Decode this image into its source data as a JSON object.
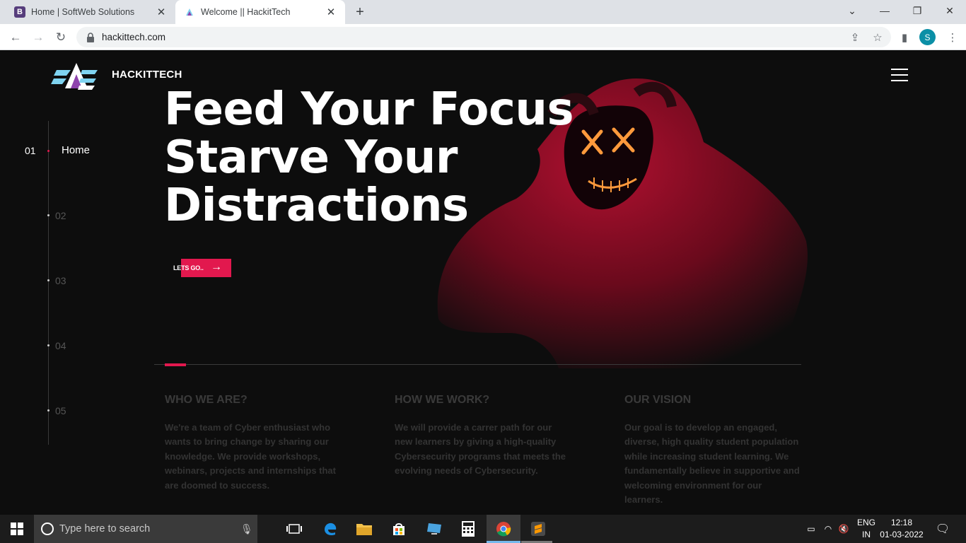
{
  "browser": {
    "tabs": [
      {
        "title": "Home | SoftWeb Solutions",
        "favicon": "B"
      },
      {
        "title": "Welcome || HackitTech"
      }
    ],
    "url": "hackittech.com",
    "profile_initial": "S"
  },
  "site": {
    "brand": "HACKITTECH",
    "headline": [
      "Feed Your Focus",
      "Starve Your",
      "Distractions"
    ],
    "cta": "LETS GO..",
    "nav": {
      "current_num": "01",
      "current_label": "Home",
      "items": [
        "02",
        "03",
        "04",
        "05"
      ]
    },
    "columns": [
      {
        "title": "WHO WE ARE?",
        "text": "We're a team of Cyber enthusiast who wants to bring change by sharing our knowledge. We provide workshops, webinars, projects and internships that are doomed to success."
      },
      {
        "title": "HOW WE WORK?",
        "text": "We will provide a carrer path for our new learners by giving a high-quality Cybersecurity programs that meets the evolving needs of Cybersecurity."
      },
      {
        "title": "OUR VISION",
        "text": "Our goal is to develop an engaged, diverse, high quality student population while increasing student learning. We fundamentally believe in supportive and welcoming environment for our learners."
      }
    ],
    "accent_color": "#e2184e"
  },
  "taskbar": {
    "search_placeholder": "Type here to search",
    "lang_line1": "ENG",
    "lang_line2": "IN",
    "time": "12:18",
    "date": "01-03-2022"
  }
}
